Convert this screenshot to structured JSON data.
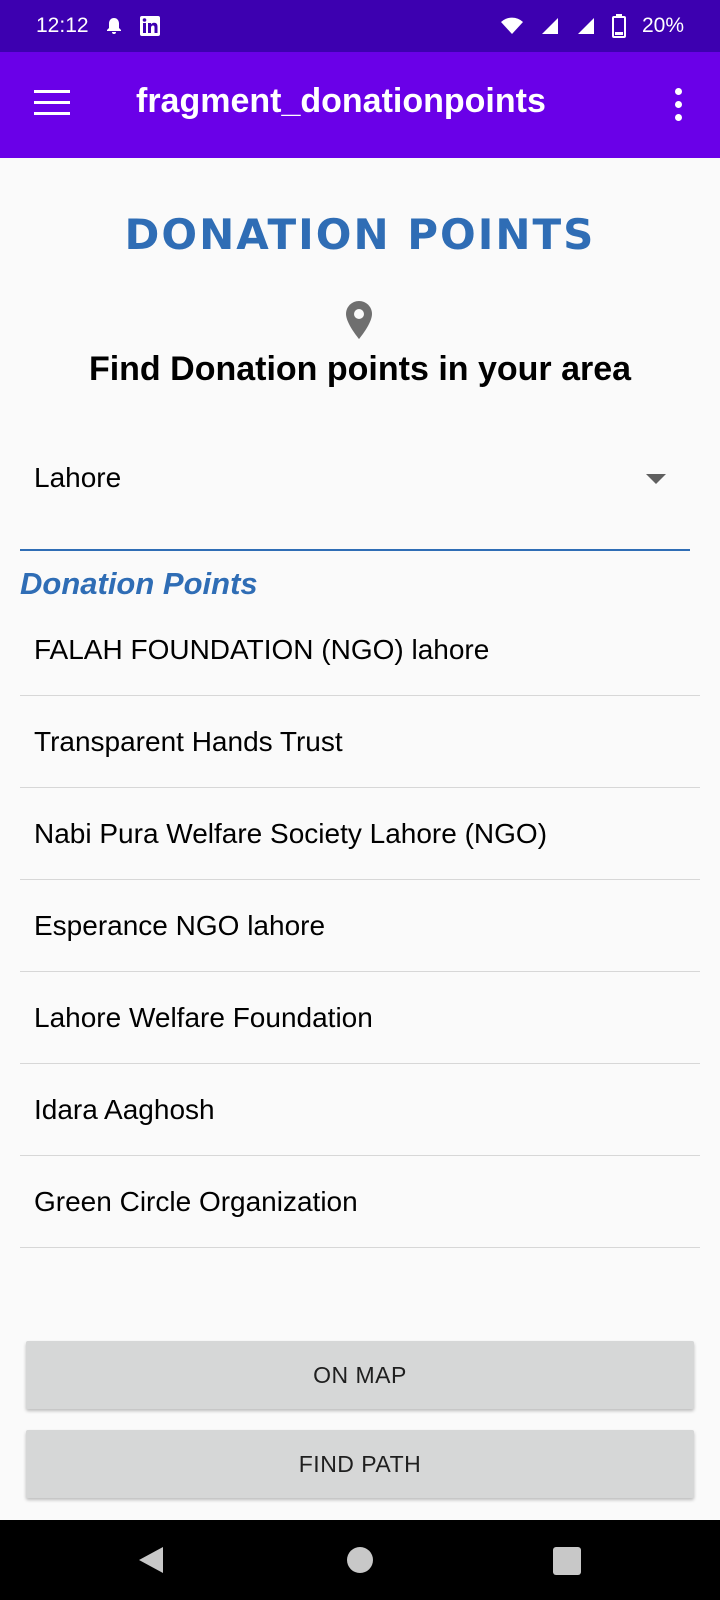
{
  "status_bar": {
    "time": "12:12",
    "battery": "20%",
    "icons": [
      "notification-bell-icon",
      "linkedin-icon",
      "wifi-icon",
      "signal-icon",
      "signal-icon",
      "battery-icon"
    ]
  },
  "app_bar": {
    "title": "fragment_donationpoints",
    "menu_icon": "hamburger-menu-icon",
    "overflow_icon": "more-vertical-icon"
  },
  "heading": "DONATION POINTS",
  "subheading": "Find Donation points in your area",
  "city_selector": {
    "selected": "Lahore"
  },
  "section_label": "Donation Points",
  "donation_points": [
    {
      "name": "FALAH FOUNDATION (NGO) lahore"
    },
    {
      "name": "Transparent Hands Trust"
    },
    {
      "name": "Nabi Pura Welfare Society Lahore (NGO)"
    },
    {
      "name": "Esperance NGO lahore"
    },
    {
      "name": "Lahore Welfare Foundation"
    },
    {
      "name": "Idara Aaghosh"
    },
    {
      "name": "Green Circle Organization"
    }
  ],
  "buttons": {
    "on_map": "ON MAP",
    "find_path": "FIND PATH"
  },
  "colors": {
    "status_bar": "#3d00b0",
    "app_bar": "#6a00e8",
    "accent_blue": "#2f6db5",
    "button_bg": "#d6d7d7"
  }
}
